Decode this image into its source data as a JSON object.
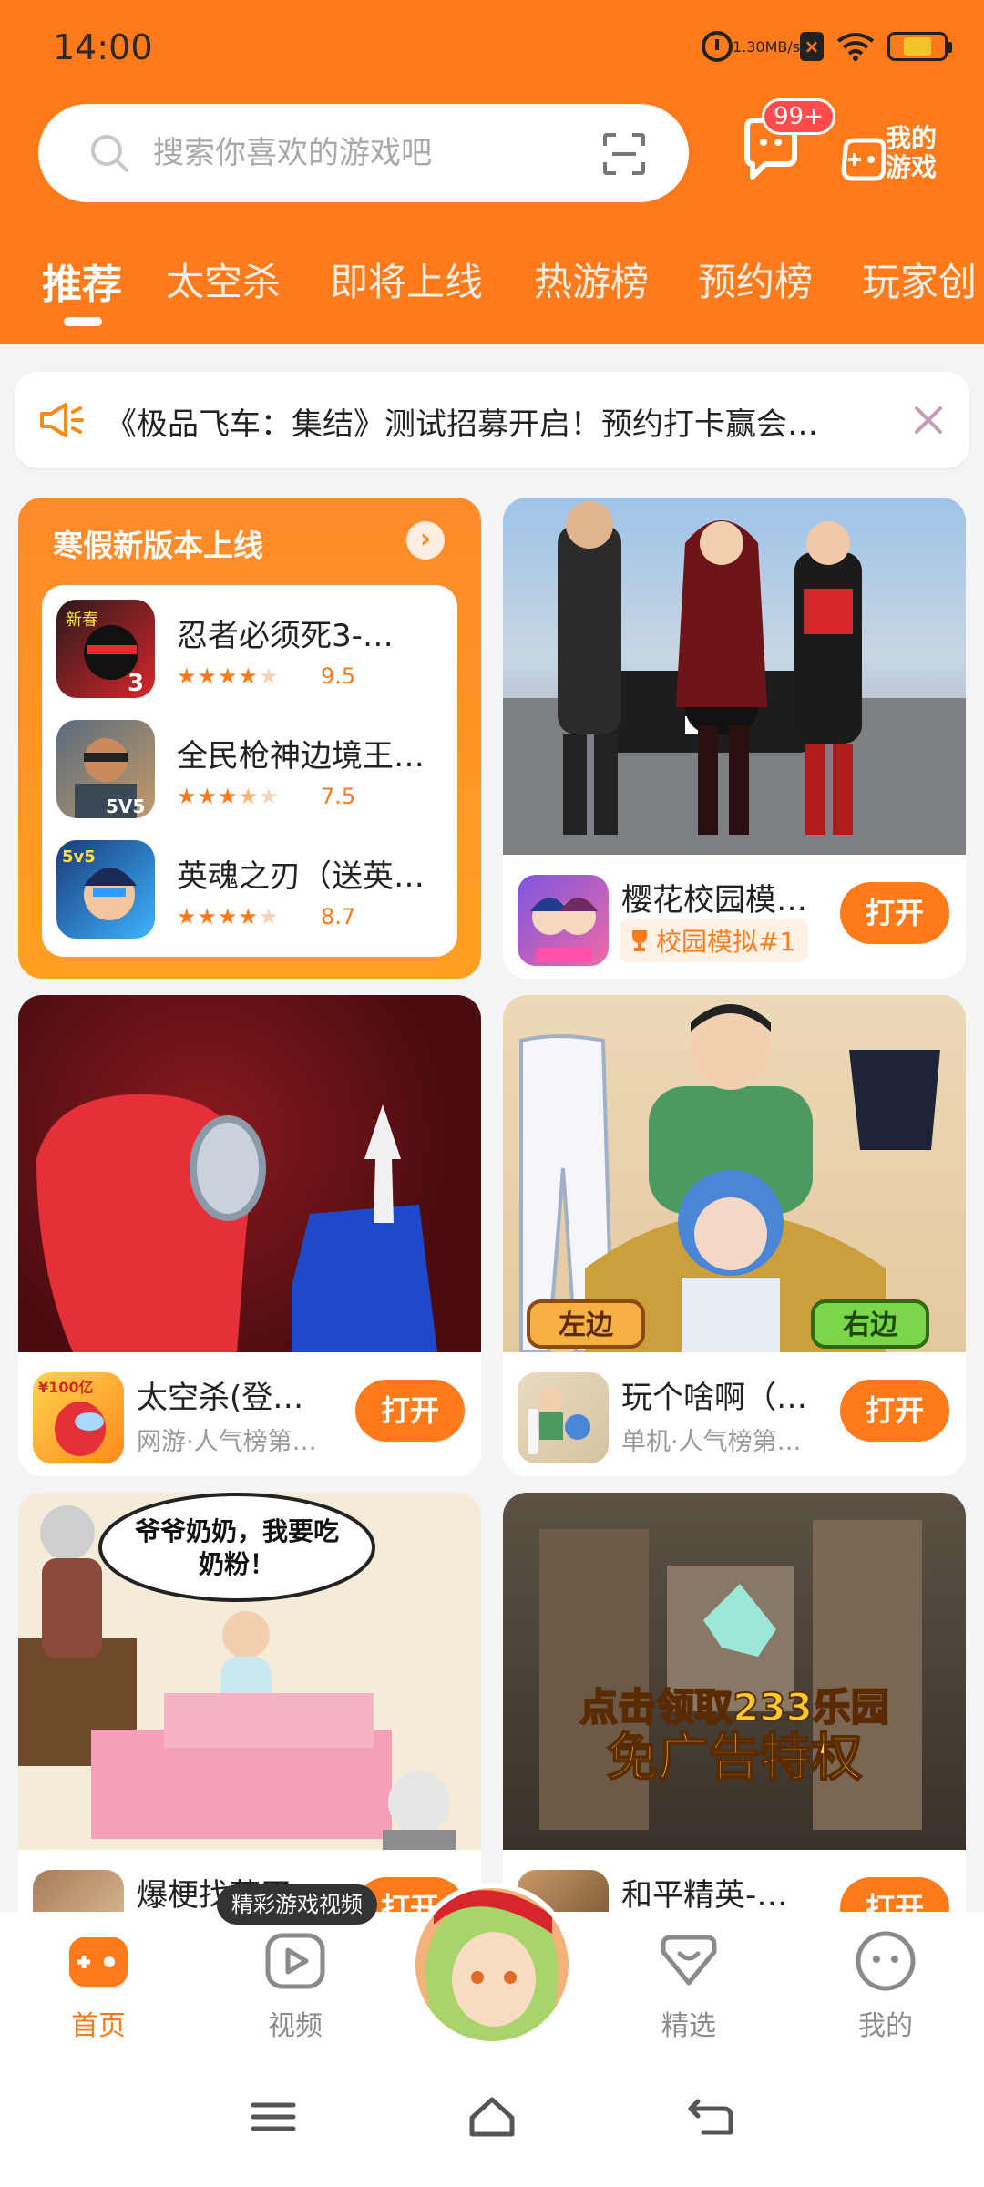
{
  "status_bar": {
    "time": "14:00",
    "net_speed_value": "1.30",
    "net_speed_unit": "MB/s"
  },
  "search": {
    "placeholder": "搜索你喜欢的游戏吧"
  },
  "header": {
    "message_badge": "99+",
    "my_games_label": "我的游戏"
  },
  "tabs": [
    {
      "label": "推荐",
      "active": true
    },
    {
      "label": "太空杀"
    },
    {
      "label": "即将上线"
    },
    {
      "label": "热游榜"
    },
    {
      "label": "预约榜"
    },
    {
      "label": "玩家创"
    }
  ],
  "notice": {
    "text": "《极品飞车：集结》测试招募开启！预约打卡赢会…"
  },
  "promo": {
    "title": "寒假新版本上线",
    "items": [
      {
        "name": "忍者必须死3-…",
        "rating": 4.5,
        "score": "9.5",
        "icon_label": "新春"
      },
      {
        "name": "全民枪神边境王…",
        "rating": 3.5,
        "score": "7.5",
        "icon_label": "5V5"
      },
      {
        "name": "英魂之刃（送英…",
        "rating": 4.5,
        "score": "8.7",
        "icon_label": "5v5"
      }
    ]
  },
  "cards": [
    {
      "name": "樱花校园模…",
      "tag": "校园模拟#1",
      "button": "打开"
    },
    {
      "name": "太空杀(登…",
      "sub": "网游·人气榜第…",
      "button": "打开",
      "icon_label": "¥100亿"
    },
    {
      "name": "玩个啥啊（…",
      "sub": "单机·人气榜第…",
      "button": "打开",
      "left_label": "左边",
      "right_label": "右边"
    },
    {
      "name": "爆梗找茬王",
      "bubble": "爷爷奶奶，我要吃奶粉！",
      "button": "打开"
    },
    {
      "name": "和平精英-…",
      "promo_line1": "点击领取233乐园",
      "promo_line2": "免广告特权",
      "button": "打开"
    }
  ],
  "bottom_nav": {
    "video_tip": "精彩游戏视频",
    "items": [
      {
        "label": "首页",
        "icon": "gamepad-icon",
        "active": true
      },
      {
        "label": "视频",
        "icon": "play-icon"
      },
      {
        "label": "精选",
        "icon": "heart-icon"
      },
      {
        "label": "我的",
        "icon": "face-icon"
      }
    ]
  },
  "colors": {
    "brand": "#ff7a1a",
    "badge": "#ff4b4b"
  }
}
